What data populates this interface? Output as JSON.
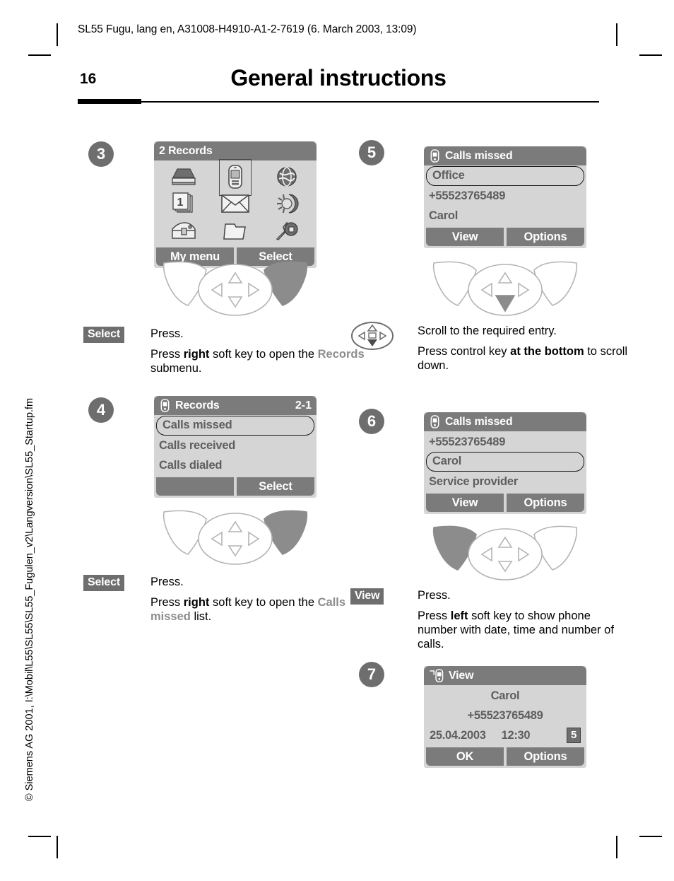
{
  "doc": {
    "running_header": "SL55 Fugu, lang en, A31008-H4910-A1-2-7619 (6. March 2003, 13:09)",
    "page_number": "16",
    "page_title": "General instructions",
    "side_note": "© Siemens AG 2001, I:\\Mobil\\L55\\SL55\\SL55_Fugulen_v2\\Langversion\\SL55_Startup.fm"
  },
  "steps": [
    {
      "id": "step3",
      "badge": "3",
      "screen": {
        "kind": "grid",
        "title": "2 Records",
        "title_right": "",
        "header_icon": "",
        "icons": [
          "phonebook-icon",
          "phone-icon",
          "internet-globe-icon",
          "messages-icon",
          "envelope-icon",
          "sun-moon-icon",
          "chest-icon",
          "folder-icon",
          "setup-wrench-icon"
        ],
        "selected_icon_index": 1,
        "softkeys": {
          "left": "My menu",
          "right": "Select"
        }
      },
      "keys": {
        "highlight": "right-softkey"
      },
      "instruction": {
        "key_label": "Select",
        "key_icon": "",
        "line1": "Press.",
        "line2_html": "Press <b>right</b> soft key to open the <span class=\"g\">Records</span> submenu."
      }
    },
    {
      "id": "step4",
      "badge": "4",
      "screen": {
        "kind": "list",
        "title": "Records",
        "title_right": "2-1",
        "header_icon": "phone-icon",
        "rows": [
          {
            "text": "Calls missed",
            "selected": true
          },
          {
            "text": "Calls received",
            "selected": false
          },
          {
            "text": "Calls dialed",
            "selected": false
          }
        ],
        "softkeys": {
          "left": "",
          "right": "Select"
        }
      },
      "keys": {
        "highlight": "right-softkey"
      },
      "instruction": {
        "key_label": "Select",
        "key_icon": "",
        "line1": "Press.",
        "line2_html": "Press <b>right</b> soft key to open the <span class=\"g\">Calls missed</span> list."
      }
    },
    {
      "id": "step5",
      "badge": "5",
      "screen": {
        "kind": "list",
        "title": "Calls missed",
        "title_right": "",
        "header_icon": "phone-icon",
        "rows": [
          {
            "text": "Office",
            "selected": true
          },
          {
            "text": "+55523765489",
            "selected": false
          },
          {
            "text": "Carol",
            "selected": false
          }
        ],
        "softkeys": {
          "left": "View",
          "right": "Options"
        }
      },
      "keys": {
        "highlight": "down-arrow"
      },
      "instruction": {
        "key_label": "",
        "key_icon": "control-key-down-icon",
        "line1": "Scroll to the required entry.",
        "line2_html": "Press control key <b>at the bottom</b> to scroll down."
      }
    },
    {
      "id": "step6",
      "badge": "6",
      "screen": {
        "kind": "list",
        "title": "Calls missed",
        "title_right": "",
        "header_icon": "phone-icon",
        "rows": [
          {
            "text": "+55523765489",
            "selected": false
          },
          {
            "text": "Carol",
            "selected": true
          },
          {
            "text": "Service provider",
            "selected": false
          }
        ],
        "softkeys": {
          "left": "View",
          "right": "Options"
        }
      },
      "keys": {
        "highlight": "left-softkey"
      },
      "instruction": {
        "key_label": "View",
        "key_icon": "",
        "line1": "Press.",
        "line2_html": "Press <b>left</b> soft key to show phone number with date, time and number of calls."
      }
    },
    {
      "id": "step7",
      "badge": "7",
      "screen": {
        "kind": "view",
        "title": "View",
        "title_right": "",
        "header_icon": "missed-call-icon",
        "name": "Carol",
        "number": "+55523765489",
        "date": "25.04.2003",
        "time": "12:30",
        "call_count": "5",
        "softkeys": {
          "left": "OK",
          "right": "Options"
        }
      },
      "keys": null,
      "instruction": null
    }
  ],
  "colors": {
    "screen_bg": "#d5d5d5",
    "titlebar": "#7b7b7b",
    "badge": "#6e6e6e",
    "screen_text": "#5e5e5e",
    "key_highlight": "#8c8c8c"
  }
}
